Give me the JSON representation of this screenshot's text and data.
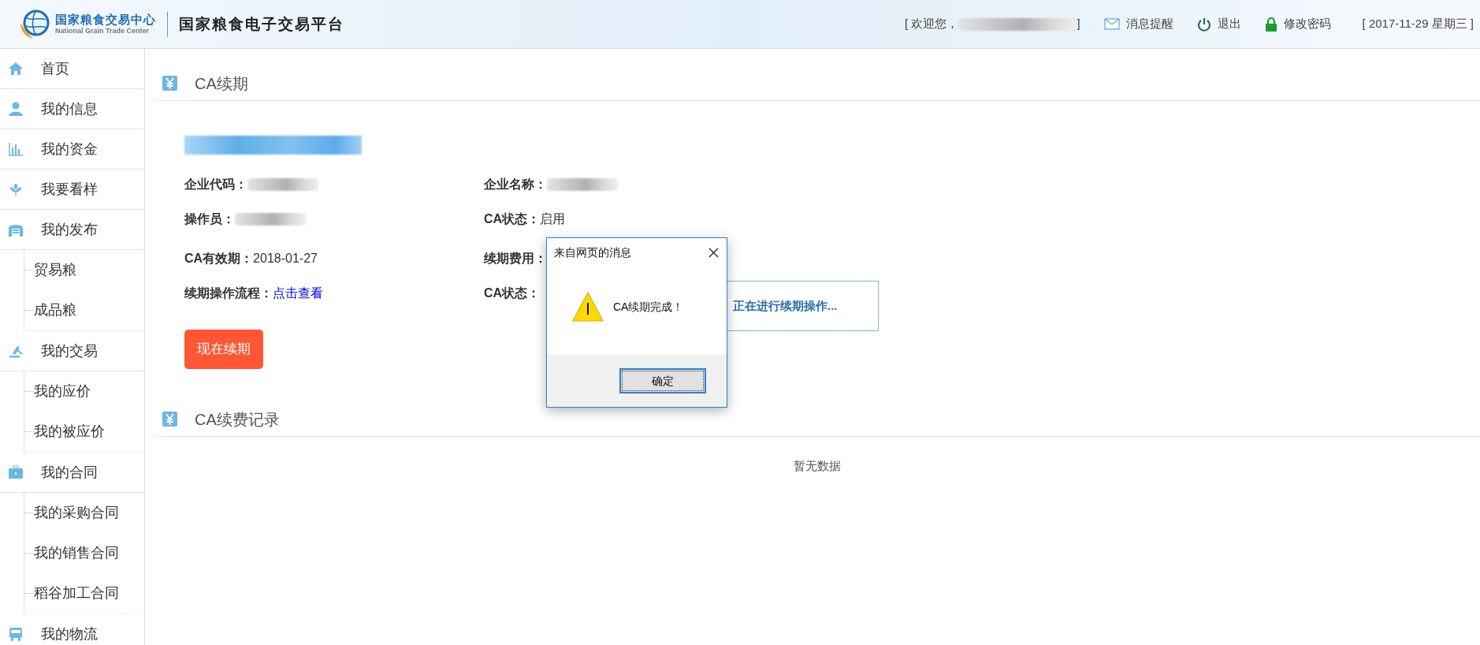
{
  "header": {
    "logo_name": "国家粮食交易中心",
    "logo_subtitle": "National Grain Trade Center",
    "platform_title": "国家粮食电子交易平台",
    "welcome_prefix": "[ 欢迎您，",
    "welcome_suffix": "]",
    "links": [
      {
        "kind": "mail",
        "label": "消息提醒"
      },
      {
        "kind": "power",
        "label": "退出"
      },
      {
        "kind": "lock",
        "label": "修改密码"
      }
    ],
    "date": "[ 2017-11-29 星期三 ]"
  },
  "sidebar": {
    "items": [
      {
        "kind": "home",
        "label": "首页"
      },
      {
        "kind": "user",
        "label": "我的信息"
      },
      {
        "kind": "chart",
        "label": "我的资金"
      },
      {
        "kind": "grain",
        "label": "我要看样"
      },
      {
        "kind": "store",
        "label": "我的发布",
        "children": [
          {
            "label": "贸易粮"
          },
          {
            "label": "成品粮"
          }
        ]
      },
      {
        "kind": "gavel",
        "label": "我的交易",
        "children": [
          {
            "label": "我的应价"
          },
          {
            "label": "我的被应价"
          }
        ]
      },
      {
        "kind": "briefcase",
        "label": "我的合同",
        "children": [
          {
            "label": "我的采购合同"
          },
          {
            "label": "我的销售合同"
          },
          {
            "label": "稻谷加工合同"
          }
        ]
      },
      {
        "kind": "bus",
        "label": "我的物流"
      }
    ]
  },
  "renewal": {
    "title": "CA续期",
    "fields": [
      {
        "label": "企业代码：",
        "kind": "redacted"
      },
      {
        "label": "企业名称：",
        "kind": "redacted"
      },
      {
        "label": "操作员：",
        "kind": "redacted"
      },
      {
        "label": "CA状态：",
        "kind": "text",
        "value": "启用"
      },
      {
        "label": "CA有效期：",
        "kind": "text",
        "value": "2018-01-27"
      },
      {
        "label": "续期费用：",
        "kind": "hidden"
      },
      {
        "label": "续期操作流程：",
        "kind": "link",
        "value": "点击查看"
      },
      {
        "label": "CA状态：",
        "kind": "hidden"
      }
    ],
    "progress_text": "正在进行续期操作...",
    "button": "现在续期"
  },
  "records": {
    "title": "CA续费记录",
    "empty_text": "暂无数据"
  },
  "dialog": {
    "title": "来自网页的消息",
    "message": "CA续期完成！",
    "button": "确定"
  }
}
